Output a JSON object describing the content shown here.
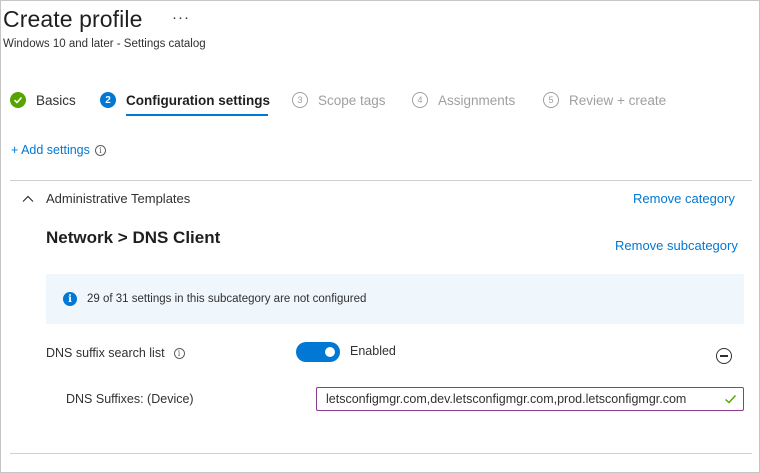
{
  "header": {
    "title": "Create profile",
    "more_icon": "more-icon",
    "more_glyph": "···",
    "subtitle": "Windows 10 and later - Settings catalog"
  },
  "steps": [
    {
      "number": "",
      "label": "Basics",
      "state": "done"
    },
    {
      "number": "2",
      "label": "Configuration settings",
      "state": "current"
    },
    {
      "number": "3",
      "label": "Scope tags",
      "state": "future"
    },
    {
      "number": "4",
      "label": "Assignments",
      "state": "future"
    },
    {
      "number": "5",
      "label": "Review + create",
      "state": "future"
    }
  ],
  "add_settings": {
    "label": "+ Add settings",
    "info_glyph": "i"
  },
  "category": {
    "title": "Administrative Templates",
    "remove_label": "Remove category",
    "subcategory_title": "Network > DNS Client",
    "remove_subcategory_label": "Remove subcategory"
  },
  "info_bar": {
    "glyph": "i",
    "text": "29 of 31 settings in this subcategory are not configured"
  },
  "setting": {
    "label": "DNS suffix search list",
    "info_glyph": "i",
    "toggle_label": "Enabled",
    "toggle_on": true
  },
  "field": {
    "label": "DNS Suffixes: (Device)",
    "value": "letsconfigmgr.com,dev.letsconfigmgr.com,prod.letsconfigmgr.com"
  },
  "colors": {
    "accent": "#0078d4",
    "success": "#57a300",
    "field_border": "#8a3a8f",
    "info_background": "#eff6fc"
  }
}
